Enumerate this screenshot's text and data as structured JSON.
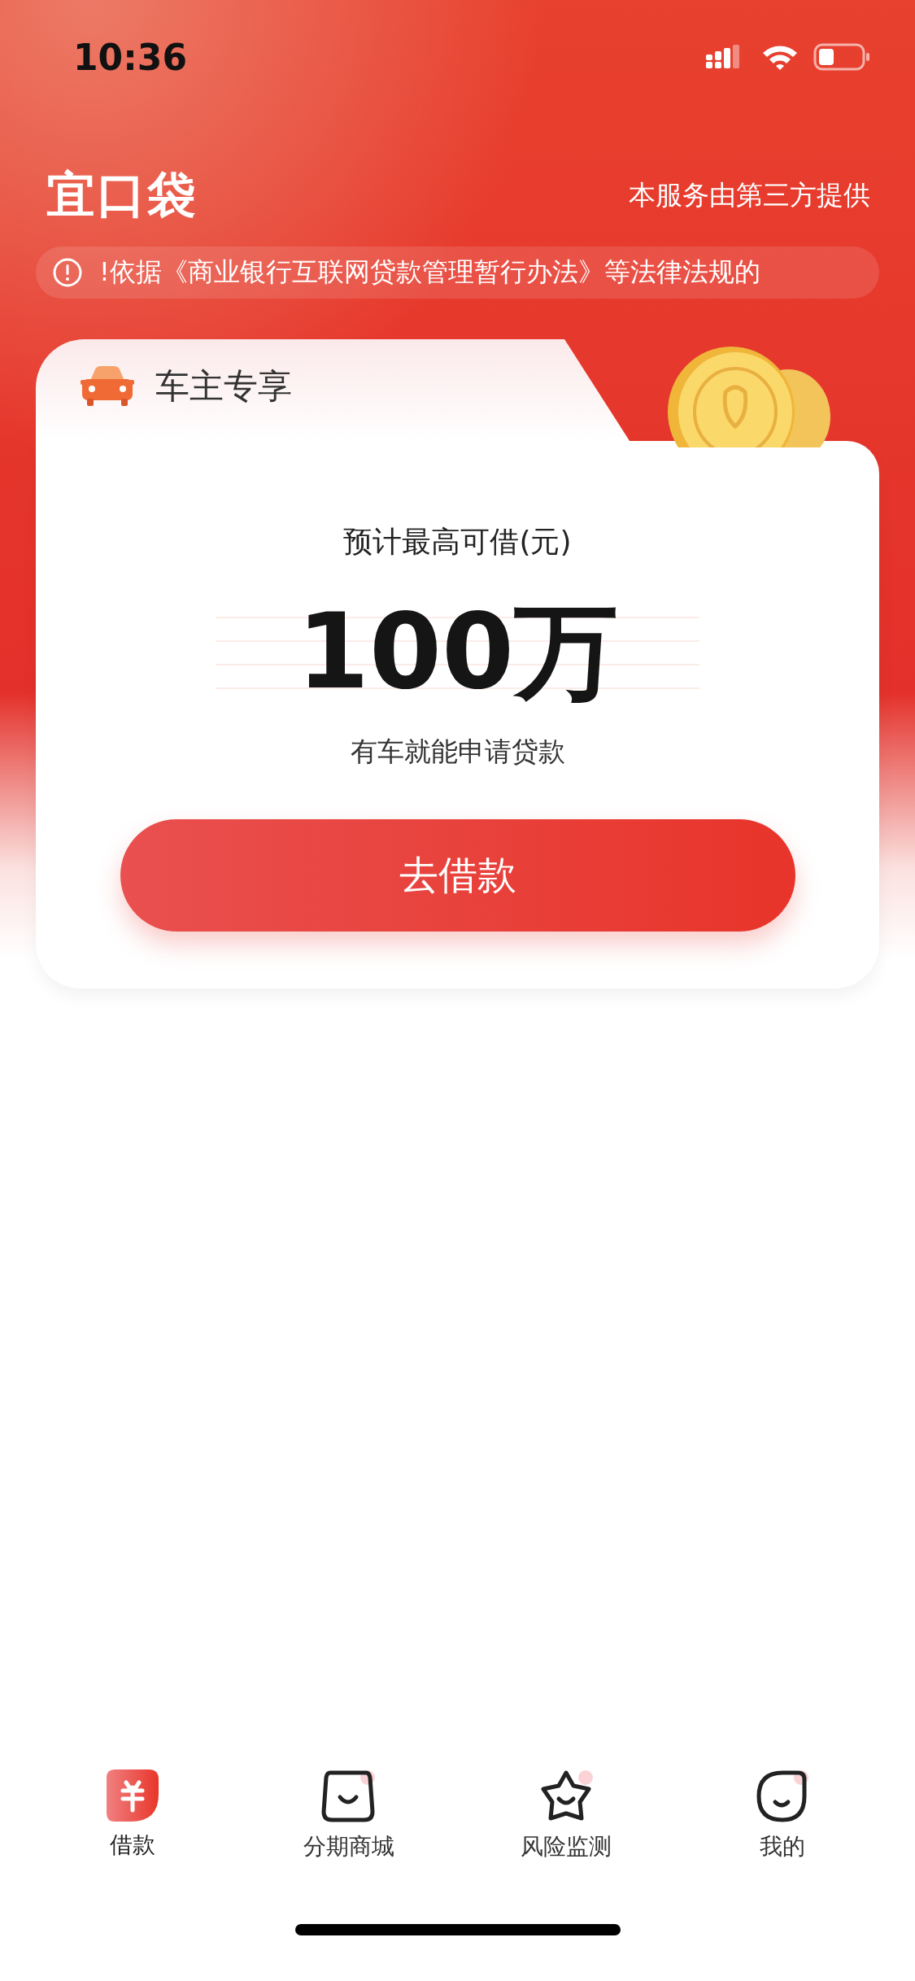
{
  "status_bar": {
    "time": "10:36"
  },
  "header": {
    "logo": "宜口袋",
    "provider_note": "本服务由第三方提供",
    "notice": "!依据《商业银行互联网贷款管理暂行办法》等法律法规的"
  },
  "card": {
    "tab_label": "车主专享",
    "amount_label": "预计最高可借(元)",
    "amount": "100万",
    "subtitle": "有车就能申请贷款",
    "button": "去借款"
  },
  "tab_bar": [
    {
      "label": "借款",
      "kind": "yuan",
      "selected": true
    },
    {
      "label": "分期商城",
      "kind": "bag",
      "selected": false
    },
    {
      "label": "风险监测",
      "kind": "star",
      "selected": false
    },
    {
      "label": "我的",
      "kind": "face",
      "selected": false
    }
  ]
}
